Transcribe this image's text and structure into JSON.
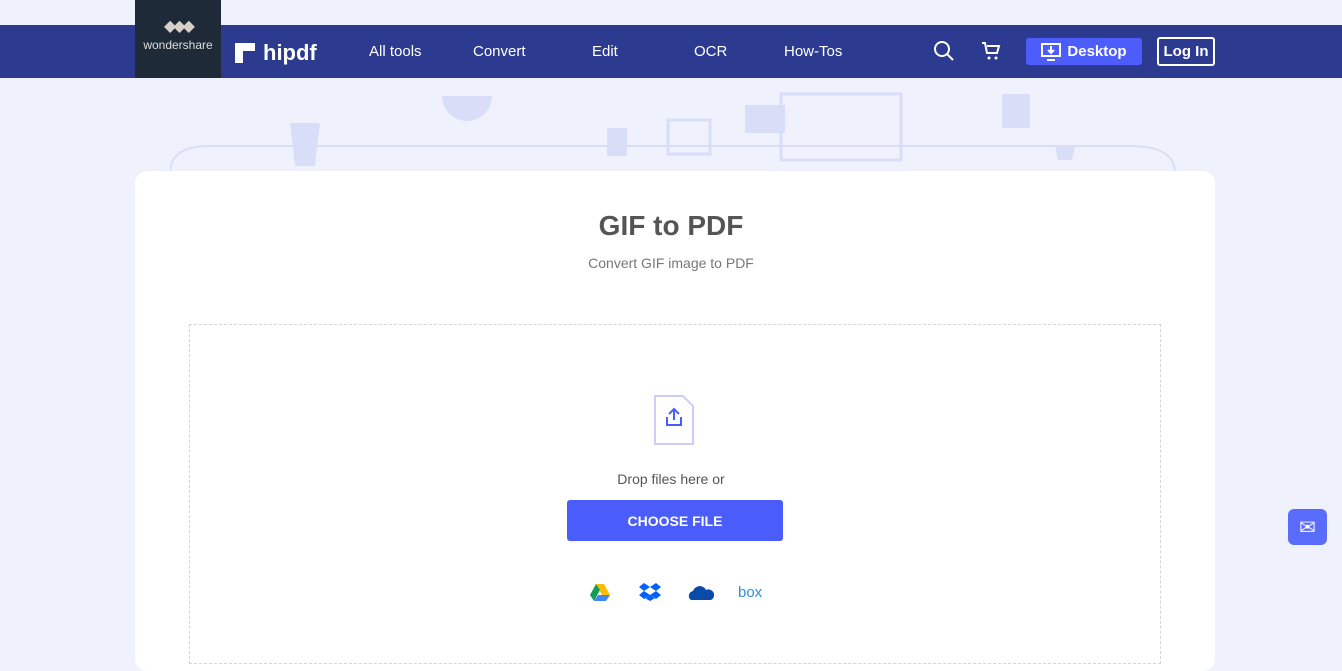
{
  "brand": {
    "parent": "wondershare",
    "name": "hipdf"
  },
  "nav": {
    "items": [
      "All tools",
      "Convert",
      "Edit",
      "OCR",
      "How-Tos"
    ],
    "desktop": "Desktop",
    "login": "Log In"
  },
  "main": {
    "title": "GIF to PDF",
    "subtitle": "Convert GIF image to PDF",
    "drop_text": "Drop files here or",
    "choose": "CHOOSE FILE",
    "box": "box"
  },
  "colors": {
    "nav": "#2c3a8f",
    "accent": "#4a5cfa"
  }
}
